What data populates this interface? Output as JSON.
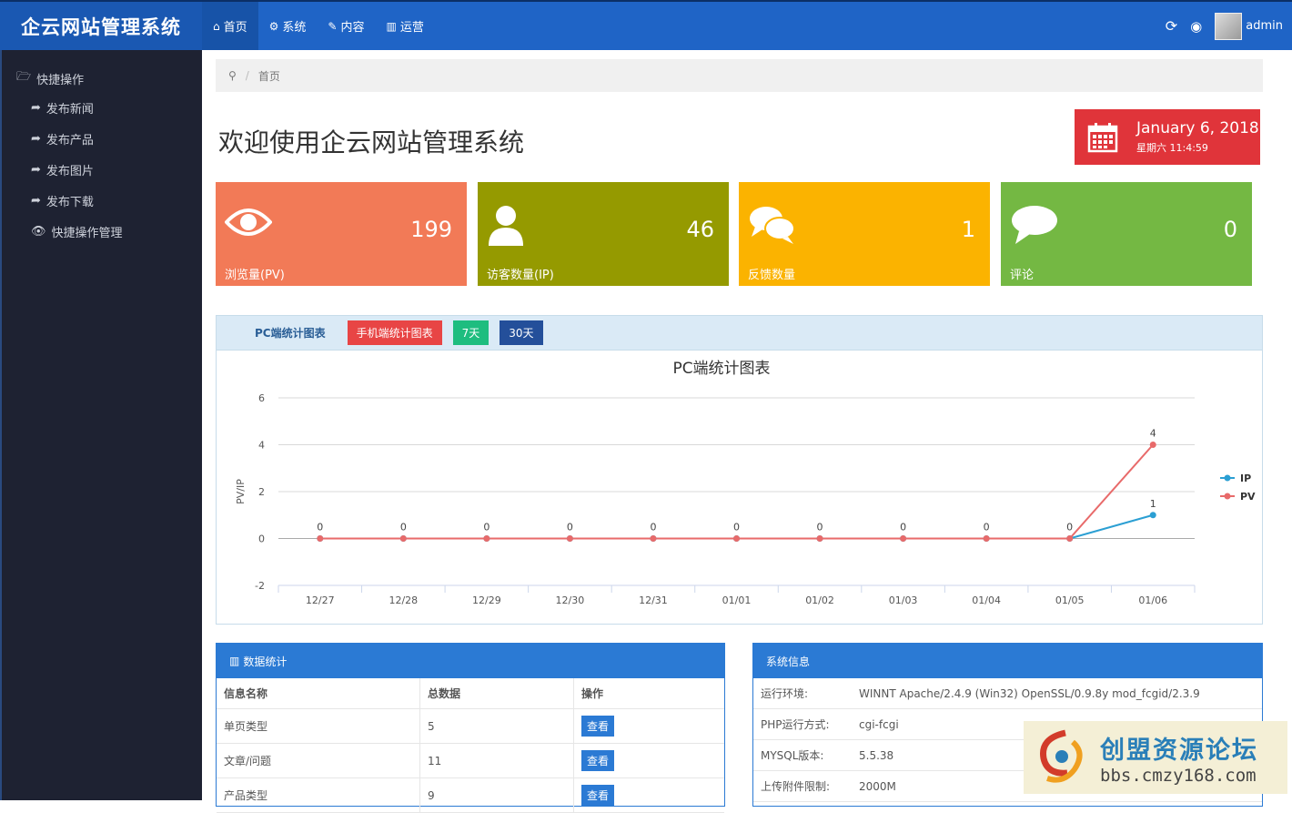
{
  "app": {
    "title": "企云网站管理系统"
  },
  "nav": [
    {
      "label": "首页",
      "icon": "home-icon"
    },
    {
      "label": "系统",
      "icon": "gears-icon"
    },
    {
      "label": "内容",
      "icon": "edit-icon"
    },
    {
      "label": "运营",
      "icon": "bar-chart-icon"
    }
  ],
  "top_right": {
    "user": "admin"
  },
  "sidebar": {
    "header": "快捷操作",
    "items": [
      "发布新闻",
      "发布产品",
      "发布图片",
      "发布下载",
      "快捷操作管理"
    ]
  },
  "breadcrumb": {
    "current": "首页"
  },
  "page": {
    "title": "欢迎使用企云网站管理系统"
  },
  "datebox": {
    "date": "January 6, 2018",
    "weekday_time": "星期六  11:4:59"
  },
  "stats": [
    {
      "value": "199",
      "label": "浏览量(PV)",
      "color": "#f27a57",
      "icon": "eye-icon"
    },
    {
      "value": "46",
      "label": "访客数量(IP)",
      "color": "#959a00",
      "icon": "user-icon"
    },
    {
      "value": "1",
      "label": "反馈数量",
      "color": "#fbb300",
      "icon": "comments-icon"
    },
    {
      "value": "0",
      "label": "评论",
      "color": "#74b843",
      "icon": "comment-icon"
    }
  ],
  "chart_panel": {
    "heading": "PC端统计图表",
    "buttons": [
      {
        "label": "手机端统计图表",
        "color": "#e84545"
      },
      {
        "label": "7天",
        "color": "#1ebd7f"
      },
      {
        "label": "30天",
        "color": "#244f9a"
      }
    ]
  },
  "chart_data": {
    "type": "line",
    "title": "PC端统计图表",
    "ylabel": "PV/IP",
    "xlabel": "",
    "categories": [
      "12/27",
      "12/28",
      "12/29",
      "12/30",
      "12/31",
      "01/01",
      "01/02",
      "01/03",
      "01/04",
      "01/05",
      "01/06"
    ],
    "yticks": [
      "6",
      "4",
      "2",
      "0",
      "-2"
    ],
    "ylim": [
      -2,
      6
    ],
    "series": [
      {
        "name": "IP",
        "values": [
          0,
          0,
          0,
          0,
          0,
          0,
          0,
          0,
          0,
          0,
          1
        ],
        "color": "#2b9fd3"
      },
      {
        "name": "PV",
        "values": [
          0,
          0,
          0,
          0,
          0,
          0,
          0,
          0,
          0,
          0,
          4
        ],
        "color": "#e86a6a"
      }
    ],
    "legend": "right",
    "grid": true
  },
  "data_panel": {
    "heading": "数据统计",
    "headers": [
      "信息名称",
      "总数据",
      "操作"
    ],
    "rows": [
      {
        "name": "单页类型",
        "count": "5",
        "action": "查看"
      },
      {
        "name": "文章/问题",
        "count": "11",
        "action": "查看"
      },
      {
        "name": "产品类型",
        "count": "9",
        "action": "查看"
      }
    ]
  },
  "sys_panel": {
    "heading": "系统信息",
    "rows": [
      {
        "key": "运行环境:",
        "value": "WINNT Apache/2.4.9 (Win32) OpenSSL/0.9.8y mod_fcgid/2.3.9"
      },
      {
        "key": "PHP运行方式:",
        "value": "cgi-fcgi"
      },
      {
        "key": "MYSQL版本:",
        "value": "5.5.38"
      },
      {
        "key": "上传附件限制:",
        "value": "2000M"
      }
    ]
  },
  "watermark": {
    "title": "创盟资源论坛",
    "url": "bbs.cmzy168.com"
  }
}
